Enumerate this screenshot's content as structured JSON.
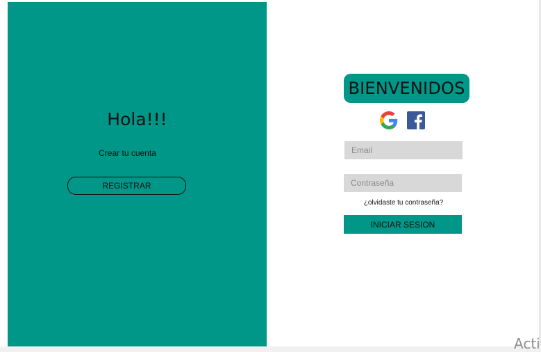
{
  "left_panel": {
    "heading": "Hola!!!",
    "subtext": "Crear tu cuenta",
    "register_label": "REGISTRAR"
  },
  "right_panel": {
    "title": "BIENVENIDOS",
    "social": [
      {
        "icon": "google-icon"
      },
      {
        "icon": "facebook-icon"
      }
    ],
    "email_placeholder": "Email",
    "password_placeholder": "Contraseña",
    "forgot_label": "¿olvidaste tu contraseña?",
    "login_label": "INICIAR SESION"
  },
  "overlay": {
    "watermark": "Activ"
  },
  "colors": {
    "accent": "#009688",
    "field_bg": "#d8d8d8"
  }
}
